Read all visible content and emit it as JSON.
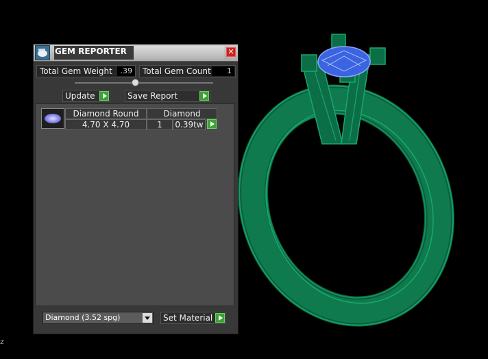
{
  "viewport": {
    "axis_label": "z",
    "model": "solitaire-ring"
  },
  "panel": {
    "title": "GEM REPORTER",
    "close_icon": "close-icon",
    "title_icon": "gem-reporter-icon",
    "total_gem_weight_label": "Total Gem Weight",
    "total_gem_weight_value": ".39",
    "total_gem_count_label": "Total Gem Count",
    "total_gem_count_value": "1",
    "update_label": "Update",
    "save_report_label": "Save Report",
    "gems": [
      {
        "shape": "Diamond Round",
        "material": "Diamond",
        "size": "4.70 X 4.70",
        "count": "1",
        "weight": "0.39tw"
      }
    ],
    "material_select": "Diamond    (3.52 spg)",
    "set_material_label": "Set Material"
  },
  "colors": {
    "ring_green": "#0c6e47",
    "gem_blue": "#3a64e0",
    "accent_green": "#3aa334"
  }
}
